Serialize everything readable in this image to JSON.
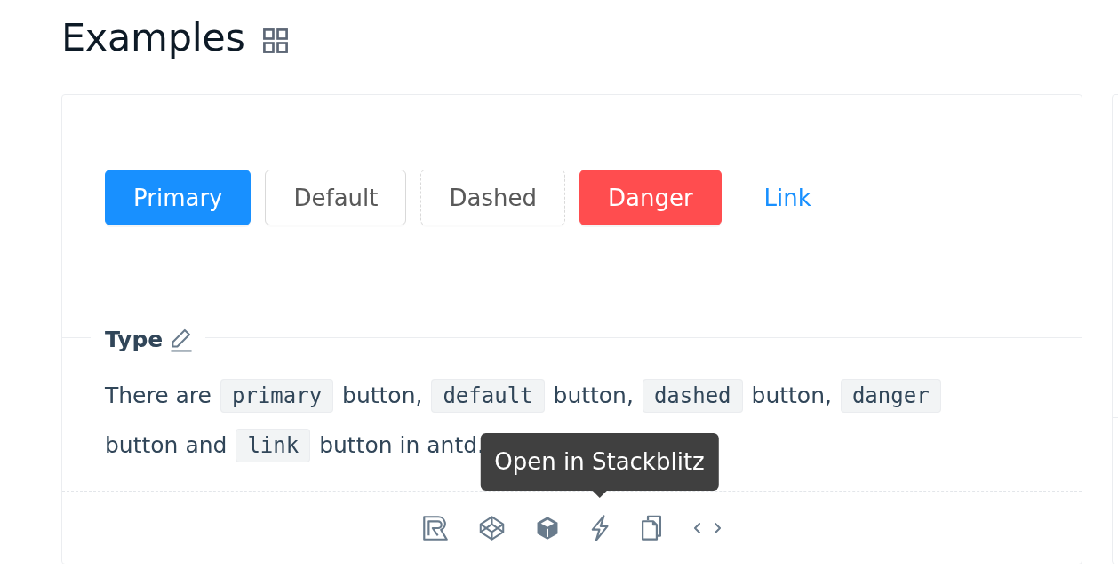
{
  "page": {
    "title": "Examples"
  },
  "demo": {
    "buttons": [
      {
        "kind": "primary",
        "label": "Primary"
      },
      {
        "kind": "default",
        "label": "Default"
      },
      {
        "kind": "dashed",
        "label": "Dashed"
      },
      {
        "kind": "danger",
        "label": "Danger"
      },
      {
        "kind": "link",
        "label": "Link"
      }
    ],
    "meta": {
      "title": "Type",
      "description": [
        {
          "kind": "text",
          "text": "There are "
        },
        {
          "kind": "code",
          "text": "primary"
        },
        {
          "kind": "text",
          "text": " button, "
        },
        {
          "kind": "code",
          "text": "default"
        },
        {
          "kind": "text",
          "text": " button, "
        },
        {
          "kind": "code",
          "text": "dashed"
        },
        {
          "kind": "text",
          "text": " button, "
        },
        {
          "kind": "code",
          "text": "danger"
        },
        {
          "kind": "text",
          "text": " button and "
        },
        {
          "kind": "code",
          "text": "link"
        },
        {
          "kind": "text",
          "text": " button in antd."
        }
      ]
    },
    "actions": [
      {
        "kind": "letter"
      },
      {
        "kind": "wireframe"
      },
      {
        "kind": "cube"
      },
      {
        "kind": "bolt",
        "tooltip": "Open in Stackblitz"
      },
      {
        "kind": "copy"
      },
      {
        "kind": "brackets"
      }
    ]
  }
}
